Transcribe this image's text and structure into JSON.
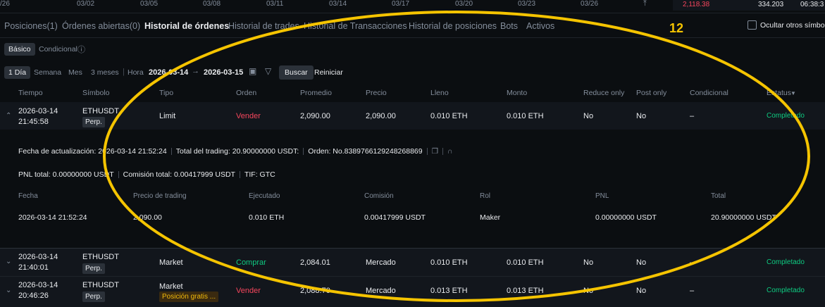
{
  "top_strip": {
    "dates": [
      "/26",
      "03/02",
      "03/05",
      "03/08",
      "03/11",
      "03/14",
      "03/17",
      "03/20",
      "03/23",
      "03/26"
    ],
    "red_value": "2,118.38",
    "value": "334.203",
    "time": "06:38:3"
  },
  "tabs": [
    {
      "label": "Posiciones(1)"
    },
    {
      "label": "Órdenes abiertas(0)"
    },
    {
      "label": "Historial de órdenes"
    },
    {
      "label": "Historial de trades"
    },
    {
      "label": "Historial de Transacciones"
    },
    {
      "label": "Historial de posiciones"
    },
    {
      "label": "Bots"
    },
    {
      "label": "Activos"
    }
  ],
  "hide_others": "Ocultar otros símbolo",
  "annotation_number": "12",
  "mode": {
    "basic": "Básico",
    "conditional": "Condicional"
  },
  "filters": {
    "ranges": [
      "1 Día",
      "Semana",
      "Mes",
      "3 meses"
    ],
    "hour_label": "Hora",
    "date_from": "2026-03-14",
    "date_to": "2026-03-15",
    "search": "Buscar",
    "reset": "Reiniciar"
  },
  "columns": [
    "Tiempo",
    "Símbolo",
    "Tipo",
    "Orden",
    "Promedio",
    "Precio",
    "Lleno",
    "Monto",
    "Reduce only",
    "Post only",
    "Condicional",
    "Estatus"
  ],
  "orders": [
    {
      "date": "2026-03-14",
      "time": "21:45:58",
      "symbol": "ETHUSDT",
      "tag": "Perp.",
      "type": "Limit",
      "side": "Vender",
      "avg": "2,090.00",
      "price": "2,090.00",
      "filled": "0.010 ETH",
      "amount": "0.010 ETH",
      "reduce": "No",
      "post": "No",
      "cond": "–",
      "status": "Completado"
    },
    {
      "date": "2026-03-14",
      "time": "21:40:01",
      "symbol": "ETHUSDT",
      "tag": "Perp.",
      "type": "Market",
      "side": "Comprar",
      "avg": "2,084.01",
      "price": "Mercado",
      "filled": "0.010 ETH",
      "amount": "0.010 ETH",
      "reduce": "No",
      "post": "No",
      "cond": "–",
      "status": "Completado"
    },
    {
      "date": "2026-03-14",
      "time": "20:46:26",
      "symbol": "ETHUSDT",
      "tag": "Perp.",
      "type": "Market",
      "extra_tag": "Posición gratis ...",
      "side": "Vender",
      "avg": "2,088.70",
      "price": "Mercado",
      "filled": "0.013 ETH",
      "amount": "0.013 ETH",
      "reduce": "No",
      "post": "No",
      "cond": "–",
      "status": "Completado"
    }
  ],
  "detail": {
    "updated": "Fecha de actualización: 2026-03-14 21:52:24",
    "total_trading": "Total del trading: 20.90000000 USDT:",
    "order_no": "Orden: No.8389766129248268869",
    "pnl_total": "PNL total: 0.00000000 USDT",
    "commission_total": "Comisión total: 0.00417999 USDT",
    "tif": "TIF: GTC",
    "columns": [
      "Fecha",
      "Precio de trading",
      "Ejecutado",
      "Comisión",
      "Rol",
      "PNL",
      "Total"
    ],
    "row": [
      "2026-03-14 21:52:24",
      "2,090.00",
      "0.010 ETH",
      "0.00417999 USDT",
      "Maker",
      "0.00000000 USDT",
      "20.90000000 USDT"
    ]
  },
  "colors": {
    "accent": "#f0b90b",
    "buy": "#0ecb81",
    "sell": "#f6465d",
    "annotation": "#f5c400"
  }
}
